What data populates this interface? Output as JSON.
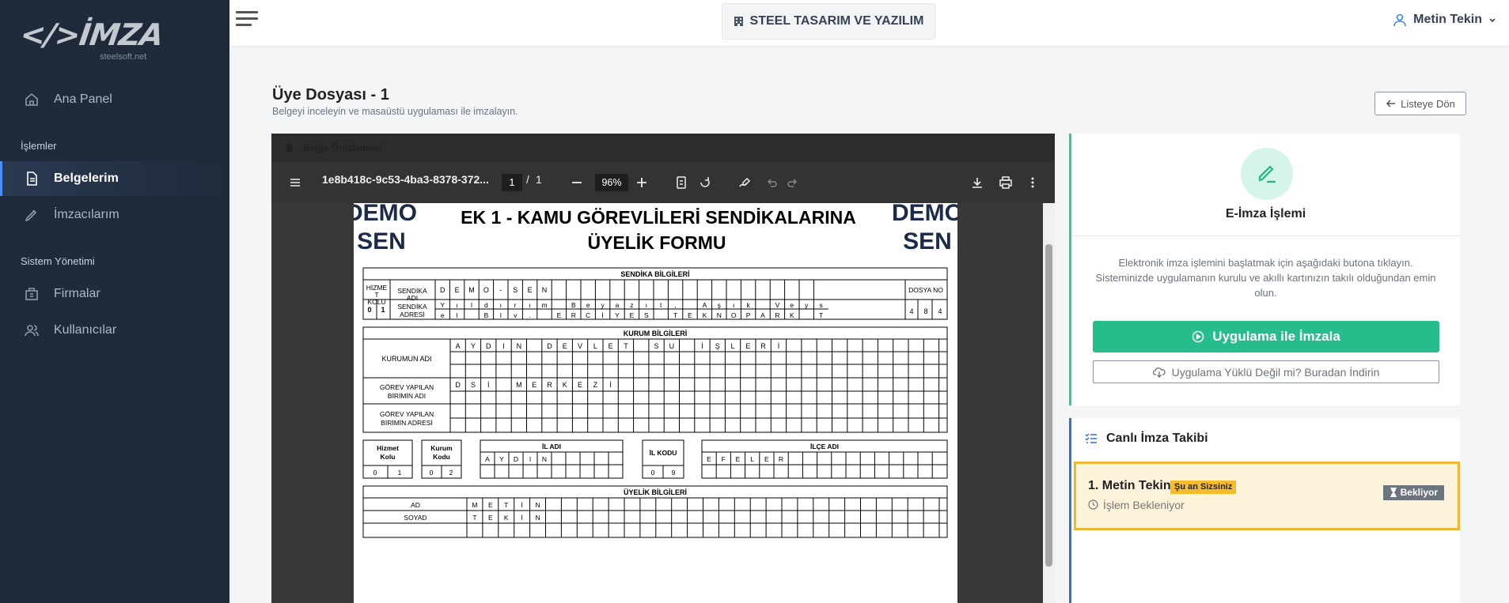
{
  "sidebar": {
    "logo_text": "İMZA",
    "logo_sub": "steelsoft.net",
    "items": [
      {
        "label": "Ana Panel",
        "icon": "home-icon"
      },
      {
        "label": "Belgelerim",
        "icon": "document-icon",
        "active": true
      },
      {
        "label": "İmzacılarım",
        "icon": "pen-icon"
      },
      {
        "label": "Firmalar",
        "icon": "building-icon"
      },
      {
        "label": "Kullanıcılar",
        "icon": "users-icon"
      }
    ],
    "sections": [
      "İşlemler",
      "Sistem Yönetimi"
    ]
  },
  "header": {
    "company": "STEEL TASARIM VE YAZILIM",
    "user": "Metin Tekin"
  },
  "page": {
    "title": "Üye Dosyası - 1",
    "subtitle": "Belgeyi inceleyin ve masaüstü uygulaması ile imzalayın.",
    "back_label": "Listeye Dön"
  },
  "viewer": {
    "panel_title": "Belge Önizlemesi",
    "file_name": "1e8b418c-9c53-4ba3-8378-372...",
    "page_current": "1",
    "page_sep": "/",
    "page_total": "1",
    "zoom": "96%"
  },
  "doc": {
    "stamp_top": "DEMO",
    "stamp_bottom": "SEN",
    "title1": "EK 1 - KAMU GÖREVLİLERİ SENDİKALARINA",
    "title2": "ÜYELİK FORMU",
    "s1": "SENDİKA BİLGİLERİ",
    "hizmet_kolu": [
      "HİZME",
      "T",
      "KOLU"
    ],
    "sendika_adi": [
      "SENDİKA",
      "ADI"
    ],
    "sendika_adi_letters": [
      "D",
      "E",
      "M",
      "O",
      "-",
      "S",
      "E",
      "N"
    ],
    "dosya_no": "DOSYA NO",
    "kolu_digits": [
      "0",
      "1"
    ],
    "sendika_adresi": [
      "SENDİKA",
      "ADRESİ"
    ],
    "addr1": [
      "Y",
      "ı",
      "l",
      "d",
      "ı",
      "r",
      "ı",
      "m",
      "",
      "B",
      "e",
      "y",
      "a",
      "z",
      "ı",
      "t",
      ",",
      "",
      "A",
      "ş",
      "ı",
      "k",
      "",
      "V",
      "e",
      "y",
      "s"
    ],
    "addr2": [
      "e",
      "l",
      "",
      "B",
      "l",
      "v",
      ".",
      "",
      "E",
      "R",
      "C",
      "İ",
      "Y",
      "E",
      "S",
      "",
      "T",
      "E",
      "K",
      "N",
      "O",
      "P",
      "A",
      "R",
      "K",
      "",
      "T"
    ],
    "dosya_digits": [
      "4",
      "8",
      "4"
    ],
    "s2": "KURUM BİLGİLERİ",
    "kurum_adi": "KURUMUN ADI",
    "kurum_letters": [
      "A",
      "Y",
      "D",
      "I",
      "N",
      "",
      "D",
      "E",
      "V",
      "L",
      "E",
      "T",
      "",
      "S",
      "U",
      "",
      "İ",
      "Ş",
      "L",
      "E",
      "R",
      "İ"
    ],
    "birim_adi": [
      "GÖREV YAPILAN",
      "BİRİMİN ADI"
    ],
    "birim_letters": [
      "D",
      "S",
      "İ",
      "",
      "M",
      "E",
      "R",
      "K",
      "E",
      "Z",
      "İ"
    ],
    "birim_adresi": [
      "GÖREV YAPILAN",
      "BİRİMİN ADRESİ"
    ],
    "hizmet_kolu2": [
      "Hizmet",
      "Kolu"
    ],
    "hizmet_digits": [
      "0",
      "1"
    ],
    "kurum_kodu": [
      "Kurum",
      "Kodu"
    ],
    "kurum_digits": [
      "0",
      "2"
    ],
    "il_adi": "İL ADI",
    "il_letters": [
      "A",
      "Y",
      "D",
      "I",
      "N"
    ],
    "il_kodu": "İL KODU",
    "il_digits": [
      "0",
      "9"
    ],
    "ilce_adi": "İLÇE ADI",
    "ilce_letters": [
      "E",
      "F",
      "E",
      "L",
      "E",
      "R"
    ],
    "s3": "ÜYELİK BİLGİLERİ",
    "ad": "AD",
    "ad_letters": [
      "M",
      "E",
      "T",
      "İ",
      "N"
    ],
    "soyad": "SOYAD",
    "soyad_letters": [
      "T",
      "E",
      "K",
      "İ",
      "N"
    ]
  },
  "sign": {
    "title": "E-İmza İşlemi",
    "desc": "Elektronik imza işlemini başlatmak için aşağıdaki butona tıklayın. Sisteminizde uygulamanın kurulu ve akıllı kartınızın takılı olduğundan emin olun.",
    "sign_label": "Uygulama ile İmzala",
    "download_label": "Uygulama Yüklü Değil mi? Buradan İndirin"
  },
  "tracking": {
    "title": "Canlı İmza Takibi",
    "name": "1. Metin Tekin",
    "badge": "Şu an Sizsiniz",
    "status": "İşlem Bekleniyor",
    "pill": "Bekliyor"
  },
  "colors": {
    "sidebar": "#1f2a3a",
    "accent_green": "#26bc8c",
    "accent_blue": "#2f6fd6",
    "warning": "#f2b634"
  }
}
